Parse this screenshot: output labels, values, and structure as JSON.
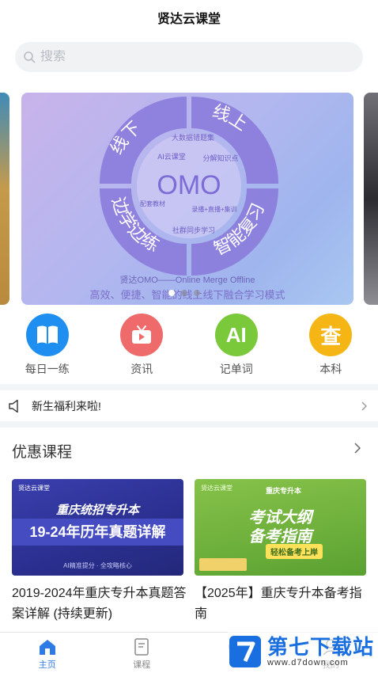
{
  "header": {
    "title": "贤达云课堂"
  },
  "search": {
    "placeholder": "搜索"
  },
  "banner": {
    "center": "OMO",
    "quadrants": [
      "线下",
      "线上",
      "边学边练",
      "智能复习"
    ],
    "inner_labels": [
      "大数据错题集",
      "AI云课堂",
      "分解知识点",
      "配套教材",
      "录播+直播+集训",
      "社群同步学习"
    ],
    "caption1": "贤达OMO——Online Merge Offline",
    "caption2": "高效、便捷、智能的线上线下融合学习模式",
    "dots": 3,
    "active_dot": 0
  },
  "quick_entries": [
    {
      "label": "每日一练",
      "icon": "book-icon",
      "color": "#1e8ff0"
    },
    {
      "label": "资讯",
      "icon": "tv-icon",
      "color": "#ef6a6a"
    },
    {
      "label": "记单词",
      "icon": "ai-icon",
      "color": "#79c93a",
      "glyph": "AI"
    },
    {
      "label": "本科",
      "icon": "search-char-icon",
      "color": "#f5b615",
      "glyph": "查"
    }
  ],
  "notice": {
    "text": "新生福利来啦!"
  },
  "section": {
    "title": "优惠课程"
  },
  "courses": [
    {
      "title": "2019-2024年重庆专升本真题答案详解 (持续更新)",
      "image": {
        "brand": "贤达云课堂",
        "line1": "重庆统招专升本",
        "line2": "19-24年历年真题详解",
        "tag": "AI精准提分 · 全攻略核心"
      }
    },
    {
      "title": "【2025年】重庆专升本备考指南",
      "image": {
        "brand": "贤达云课堂",
        "top": "重庆专升本",
        "line1": "考试大纲",
        "line2": "备考指南",
        "tag": "轻松备考上岸"
      }
    }
  ],
  "tabbar": [
    {
      "label": "主页",
      "icon": "home-icon",
      "active": true
    },
    {
      "label": "课程",
      "icon": "course-icon",
      "active": false
    },
    {
      "label": "",
      "icon": "study-icon",
      "active": false
    },
    {
      "label": "我的",
      "icon": "profile-icon",
      "active": false
    }
  ],
  "watermark": {
    "title": "第七下载站",
    "url": "www.d7down.com"
  },
  "colors": {
    "accent": "#2f7be6",
    "banner_ring": "#8b7bdc"
  }
}
